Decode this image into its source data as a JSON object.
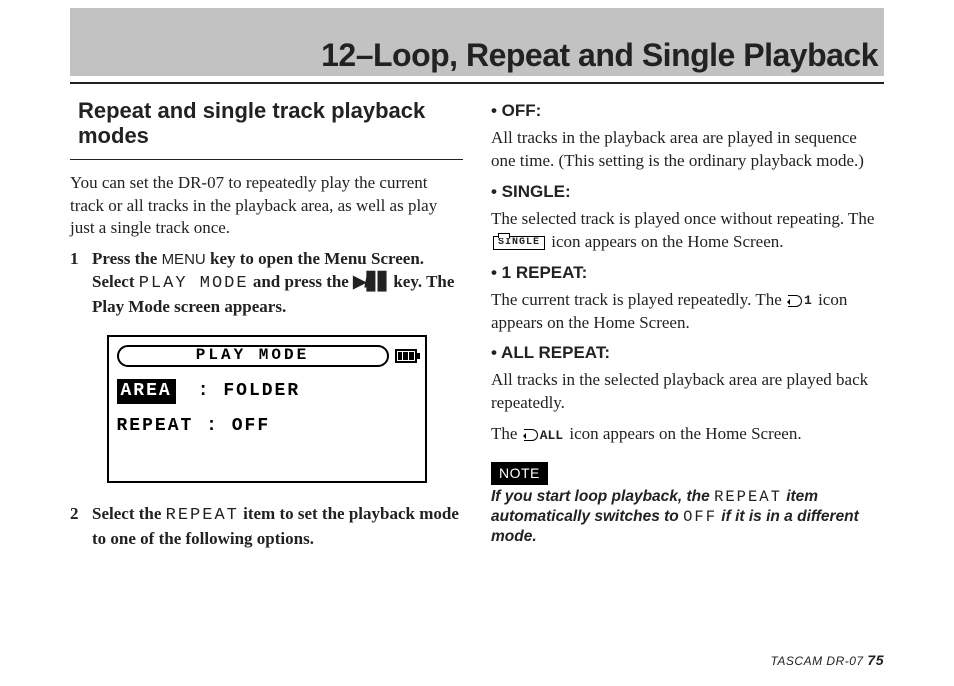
{
  "banner": {
    "title": "12–Loop, Repeat and Single Playback"
  },
  "left": {
    "section_title": "Repeat and single track playback modes",
    "intro": "You can set the DR-07 to repeatedly play the current track or all tracks in the playback area, as well as play just a single track once.",
    "step1": {
      "num": "1",
      "a": "Press the ",
      "menu": "MENU",
      "b": " key to open the Menu Screen. Select ",
      "mono": "PLAY MODE",
      "c": " and press the ",
      "play": "▶/▋▋",
      "d": " key.  The Play Mode screen appears."
    },
    "lcd": {
      "title": "PLAY MODE",
      "row1_label": "AREA",
      "row1_sep": " :",
      "row1_val": "FOLDER",
      "row2_label": "REPEAT",
      "row2_sep": ":",
      "row2_val": "OFF"
    },
    "step2": {
      "num": "2",
      "a": "Select the ",
      "mono": "REPEAT",
      "b": " item to set the playback mode to one of the following options."
    }
  },
  "right": {
    "off": {
      "head": "• OFF:",
      "body": "All tracks in the playback area are played in sequence one time. (This setting is the ordinary playback mode.)"
    },
    "single": {
      "head": "• SINGLE:",
      "body_a": "The selected track is played once without repeating. The ",
      "icon": "SINGLE",
      "body_b": " icon appears on the Home Screen."
    },
    "one": {
      "head": "• 1 REPEAT:",
      "body_a": "The current track is played repeatedly. The ",
      "suffix": "1",
      "body_b": " icon appears on the Home Screen."
    },
    "all": {
      "head": "• ALL REPEAT:",
      "body1": "All tracks in the selected playback area are played back repeatedly.",
      "body2_a": "The ",
      "suffix": "ALL",
      "body2_b": " icon appears on the Home Screen."
    },
    "note": {
      "badge": "NOTE",
      "a": "If you start loop playback, the ",
      "mono1": "REPEAT",
      "b": " item automatically switches to ",
      "mono2": "OFF",
      "c": " if it is in a different mode."
    }
  },
  "footer": {
    "model": "TASCAM  DR-07 ",
    "page": "75"
  }
}
